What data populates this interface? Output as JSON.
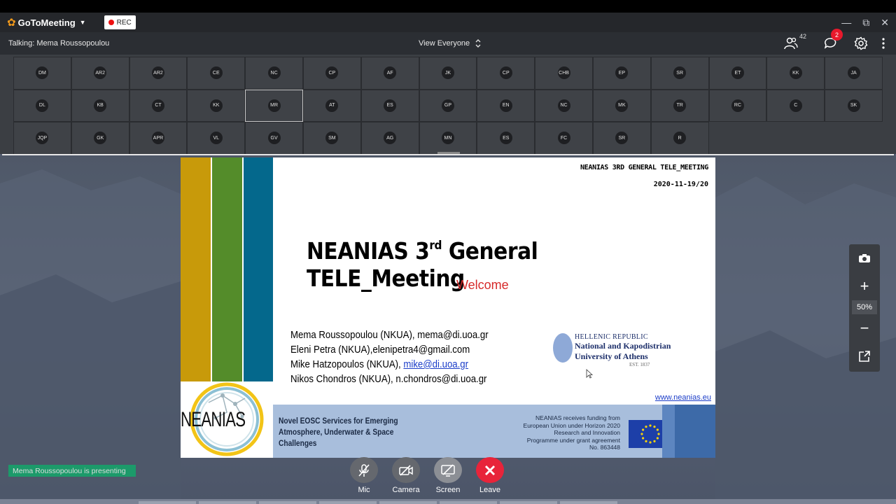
{
  "app": {
    "name": "GoToMeeting",
    "rec_label": "REC"
  },
  "infobar": {
    "talking": "Talking: Mema Roussopoulou",
    "view": "View Everyone",
    "participants_count": "42",
    "chat_badge": "2"
  },
  "attendees": [
    "DM",
    "AR2",
    "AR2",
    "CE",
    "NC",
    "CP",
    "AF",
    "JK",
    "CP",
    "CHB",
    "EP",
    "SR",
    "ET",
    "KK",
    "JA",
    "DL",
    "KB",
    "CT",
    "KK",
    "MR",
    "AT",
    "ES",
    "GP",
    "EN",
    "NC",
    "MK",
    "TR",
    "RC",
    "C",
    "SK",
    "JQP",
    "GK",
    "APR",
    "VL",
    "GV",
    "SM",
    "AG",
    "MN",
    "ES",
    "FC",
    "SR",
    "R"
  ],
  "slide": {
    "header_line1": "NEANIAS 3RD GENERAL TELE_MEETING",
    "header_line2": "2020-11-19/20",
    "title_pre": "NEANIAS 3",
    "title_sup": "rd",
    "title_post": " General TELE_Meeting",
    "subtitle": "Welcome",
    "authors": [
      "Mema Roussopoulou (NKUA), mema@di.uoa.gr",
      "Eleni Petra (NKUA),elenipetra4@gmail.com",
      "Mike Hatzopoulos (NKUA), ",
      "Nikos Chondros (NKUA), n.chondros@di.uoa.gr"
    ],
    "author3_link": "mike@di.uoa.gr",
    "uni_line1": "HELLENIC REPUBLIC",
    "uni_line2": "National and Kapodistrian",
    "uni_line3": "University of Athens",
    "uni_line4": "EST. 1837",
    "website": "www.neanias.eu",
    "logo_word": "NEANIAS",
    "tagline": [
      "Novel EOSC Services for Emerging",
      "Atmosphere, Underwater & Space",
      "Challenges"
    ],
    "funding": [
      "NEANIAS receives funding from",
      "European Union under Horizon 2020",
      "Research and Innovation",
      "Programme under grant agreement",
      "No. 863448"
    ]
  },
  "zoom": {
    "level": "50%"
  },
  "presenting": "Mema Roussopoulou is presenting",
  "controls": {
    "mic": "Mic",
    "camera": "Camera",
    "screen": "Screen",
    "leave": "Leave"
  },
  "colors": {
    "bar1": "#c89a0a",
    "bar2": "#548c2a",
    "bar3": "#04688c",
    "leave": "#e8243a",
    "presenting": "#1c9a6a"
  }
}
